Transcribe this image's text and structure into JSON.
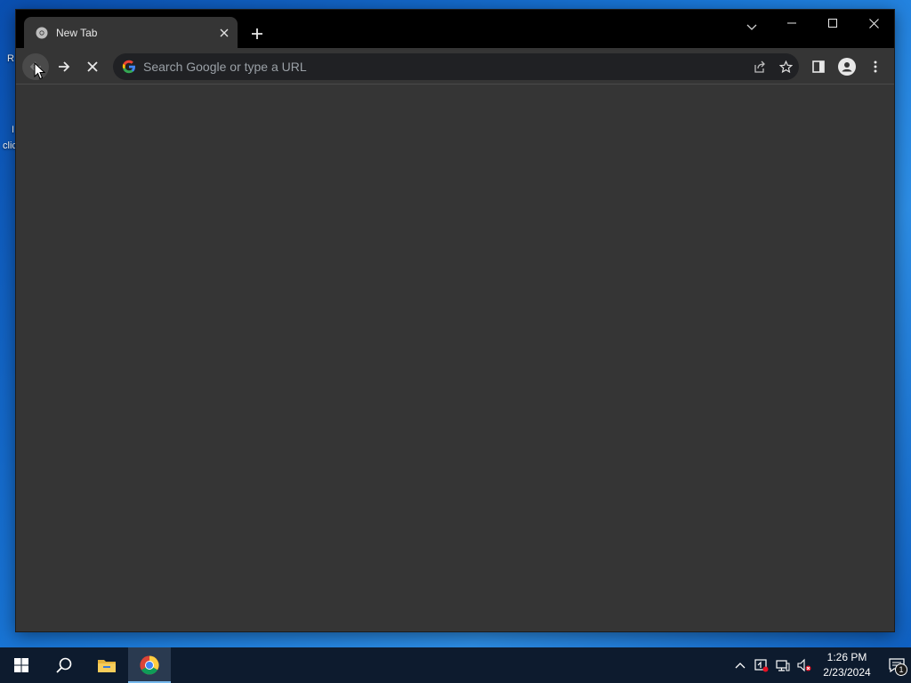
{
  "desktop": {
    "fragments": [
      "R",
      "I",
      "clic"
    ]
  },
  "browser": {
    "tab": {
      "title": "New Tab",
      "favicon": "chrome-icon"
    },
    "omnibox": {
      "placeholder": "Search Google or type a URL",
      "value": ""
    },
    "state": "loading"
  },
  "taskbar": {
    "apps": [
      {
        "name": "Start",
        "icon": "windows-icon"
      },
      {
        "name": "Search",
        "icon": "search-icon"
      },
      {
        "name": "File Explorer",
        "icon": "folder-icon"
      },
      {
        "name": "Google Chrome",
        "icon": "chrome-icon",
        "active": true
      }
    ],
    "clock": {
      "time": "1:26 PM",
      "date": "2/23/2024"
    },
    "notifications_count": "1"
  },
  "colors": {
    "titlebar": "#000000",
    "toolbar": "#353535",
    "omnibox": "#202124",
    "taskbar": "#0d1b2e",
    "accent": "#76b9ed"
  }
}
